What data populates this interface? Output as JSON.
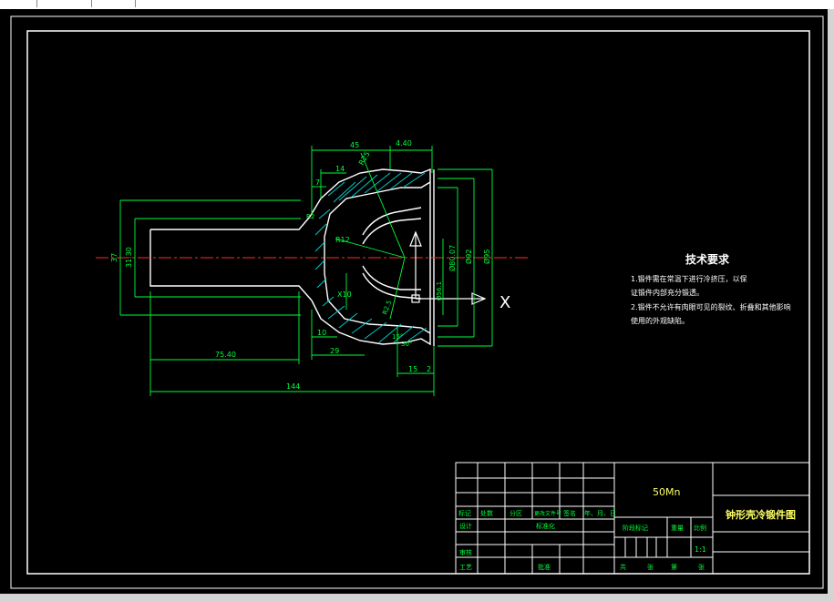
{
  "window": {
    "colors": {
      "background": "#000000",
      "border": "#ffffff",
      "geometry": "#ffffff",
      "dimension": "#00ff3c",
      "centerline": "#ff2a2a",
      "hatch": "#00c8c8",
      "note_text": "#ffffff",
      "title_text": "#00ff3c"
    }
  },
  "drawing": {
    "dimensions": {
      "d45": "45",
      "d4_40": "4.40",
      "d14": "14",
      "d7": "7",
      "r_top": "R25",
      "r_mid": "R12",
      "r_small": "R2",
      "x10": "X10",
      "r_low": "R2.5",
      "d37": "37",
      "d31_3": "31.30",
      "d80": "Ø80.07",
      "d92": "Ø92",
      "d95": "Ø95",
      "d56": "Ø56.1",
      "d75": "75.40",
      "d10": "10",
      "d29": "29",
      "d15deg": "15°",
      "d30": "30°",
      "d15": "15",
      "d2": "2",
      "d144": "144"
    },
    "axis_label": "X"
  },
  "notes": {
    "title": "技术要求",
    "line1": "1.锻件需在常温下进行冷挤压，以保",
    "line1b": "证锻件内部充分锻透。",
    "line2": "2.锻件不允许有肉眼可见的裂纹、折叠和其他影响",
    "line2b": "使用的外观缺陷。"
  },
  "title_block": {
    "material": "50Mn",
    "part_name": "钟形壳冷锻件图",
    "row_headers": [
      "标记",
      "处数",
      "分区",
      "更改文件号",
      "签名",
      "年、月、日"
    ],
    "design": "设计",
    "standardize": "标准化",
    "review": "审核",
    "process": "工艺",
    "approve": "批准",
    "stage_mark": "阶段标记",
    "weight": "重量",
    "scale_label": "比例",
    "scale": "1:1",
    "total": "共",
    "sheets": "张",
    "sheet_no": "第",
    "sheet_unit": "张"
  }
}
